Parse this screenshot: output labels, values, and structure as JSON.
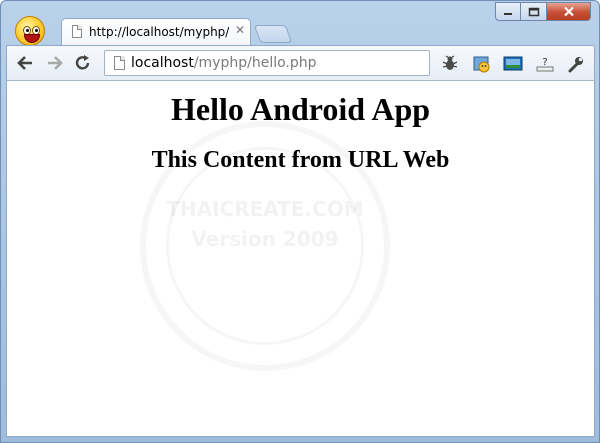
{
  "browser": {
    "tab": {
      "title": "http://localhost/myphp/hello.php",
      "close_glyph": "✕"
    },
    "address": {
      "host": "localhost",
      "path": "/myphp/hello.php"
    },
    "icons": {
      "profile": "smiley-avatar-icon",
      "back": "back-arrow-icon",
      "forward": "forward-arrow-icon",
      "reload": "reload-icon",
      "page": "page-icon",
      "ext1": "bug-extension-icon",
      "ext2": "stamp-extension-icon",
      "ext3": "screen-extension-icon",
      "ext4": "help-extension-icon",
      "settings": "wrench-icon"
    }
  },
  "page": {
    "heading": "Hello Android App",
    "subheading": "This Content from URL Web",
    "watermark": {
      "line1": "THAICREATE.COM",
      "line2": "Version 2009"
    }
  }
}
